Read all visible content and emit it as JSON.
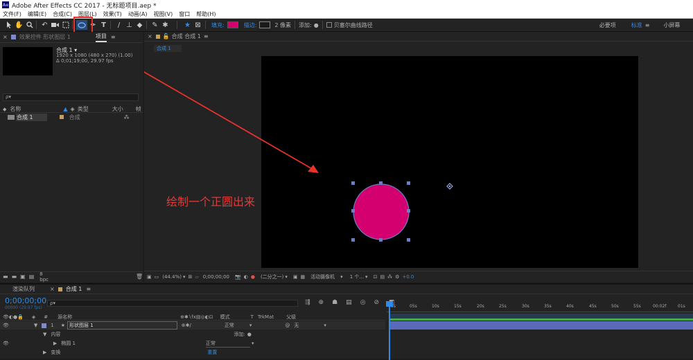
{
  "titlebar": {
    "title": "Adobe After Effects CC 2017 - 无标题项目.aep *",
    "logo": "Ae"
  },
  "menu": [
    "文件(F)",
    "编辑(E)",
    "合成(C)",
    "图层(L)",
    "效果(T)",
    "动画(A)",
    "视图(V)",
    "窗口",
    "帮助(H)"
  ],
  "toolbar": {
    "fill_label": "填充:",
    "stroke_label": "描边:",
    "stroke_width": "2 像素",
    "add_label": "添加:",
    "bezier_label": "贝塞尔曲线路径",
    "workspaces": [
      "必要项",
      "标准",
      "小屏幕"
    ],
    "fill_color": "#d4006f",
    "stroke_color": "#1a1a1a"
  },
  "project_panel": {
    "tab_effects": "效果控件 形状图层 1",
    "tab_project": "项目",
    "comp_name": "合成 1",
    "comp_resolution": "1920 x 1080  (480 x 270) (1.00)",
    "comp_duration": "Δ 0;01;19;00, 29.97 fps",
    "search_placeholder": "ρ▾",
    "col_name": "名称",
    "col_type": "类型",
    "col_size": "大小",
    "col_frame": "帧",
    "item_name": "合成 1",
    "item_type": "合成",
    "bpc": "8 bpc"
  },
  "comp_panel": {
    "tab_title": "合成 合成 1",
    "subtab": "合成 1",
    "annotation": "绘制一个正圆出来",
    "circle_color": "#d4006f",
    "zoom": "(44.4%)",
    "timecode": "0;00;00;00",
    "resolution": "(二分之一)",
    "camera": "活动摄像机",
    "views": "1 个...",
    "exposure": "+0.0"
  },
  "timeline": {
    "tab_render": "渲染队列",
    "tab_comp": "合成 1",
    "timecode": "0;00;00;00",
    "timecode_sub": "00000 (29.97 fps)",
    "col_num": "#",
    "col_source": "源名称",
    "col_mode": "模式",
    "col_trkmat": "TrkMat",
    "col_parent": "父级",
    "layer_num": "1",
    "layer_name": "形状图层 1",
    "layer_mode": "正常",
    "layer_parent": "无",
    "row_content": "内容",
    "row_add": "添加:",
    "row_ellipse": "椭圆 1",
    "row_ellipse_mode": "正常",
    "row_transform": "变换",
    "row_reset": "重置",
    "ruler": [
      "0s",
      "05s",
      "10s",
      "15s",
      "20s",
      "25s",
      "30s",
      "35s",
      "40s",
      "45s",
      "50s",
      "55s",
      "00:02f",
      "01s"
    ]
  }
}
